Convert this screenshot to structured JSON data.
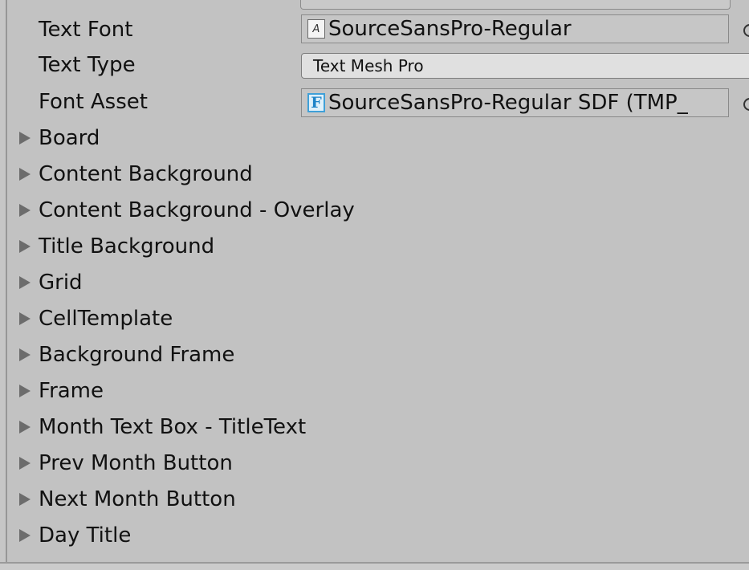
{
  "properties": [
    {
      "label": "Text Font",
      "value": "SourceSansPro-Regular",
      "icon": "font-asset-icon"
    },
    {
      "label": "Text Type",
      "value": "Text Mesh Pro"
    },
    {
      "label": "Font Asset",
      "value": "SourceSansPro-Regular SDF (TMP_",
      "icon": "tmp-font-asset-icon",
      "icon_glyph": "F"
    }
  ],
  "icons": {
    "font_glyph": "A",
    "foldout": "triangle-right-icon"
  },
  "foldouts": [
    "Board",
    "Content Background",
    "Content Background - Overlay",
    "Title Background",
    "Grid",
    "CellTemplate",
    "Background Frame",
    "Frame",
    "Month Text Box - TitleText",
    "Prev Month Button",
    "Next Month Button",
    "Day Title"
  ]
}
